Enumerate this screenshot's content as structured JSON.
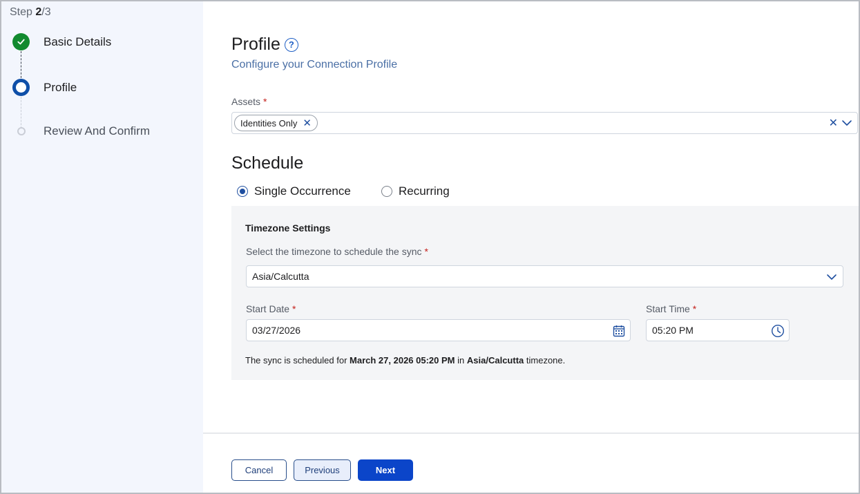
{
  "stepper": {
    "step_word": "Step",
    "current": "2",
    "total": "/3",
    "steps": [
      {
        "label": "Basic Details",
        "status": "completed"
      },
      {
        "label": "Profile",
        "status": "active"
      },
      {
        "label": "Review And Confirm",
        "status": "pending"
      }
    ]
  },
  "profile": {
    "title": "Profile",
    "help_glyph": "?",
    "subtitle": "Configure your Connection Profile"
  },
  "assets": {
    "label": "Assets",
    "required": "*",
    "selected": [
      {
        "label": "Identities Only",
        "remove_glyph": "✕"
      }
    ],
    "clear_glyph": "✕"
  },
  "schedule": {
    "title": "Schedule",
    "options": [
      {
        "label": "Single Occurrence",
        "selected": true
      },
      {
        "label": "Recurring",
        "selected": false
      }
    ]
  },
  "timezone": {
    "title": "Timezone Settings",
    "select_label": "Select the timezone to schedule the sync",
    "required": "*",
    "value": "Asia/Calcutta"
  },
  "start_date": {
    "label": "Start Date",
    "required": "*",
    "value": "03/27/2026"
  },
  "start_time": {
    "label": "Start Time",
    "required": "*",
    "value": "05:20 PM"
  },
  "summary": {
    "prefix": "The sync is scheduled for",
    "datetime": "March 27, 2026 05:20 PM",
    "in": "in",
    "zone": "Asia/Calcutta",
    "suffix": "timezone."
  },
  "buttons": {
    "cancel": "Cancel",
    "previous": "Previous",
    "next": "Next"
  },
  "colors": {
    "primary": "#0b45c9",
    "success": "#128a2f",
    "required": "#c4201b",
    "sidebar_bg": "#f3f6fd"
  }
}
